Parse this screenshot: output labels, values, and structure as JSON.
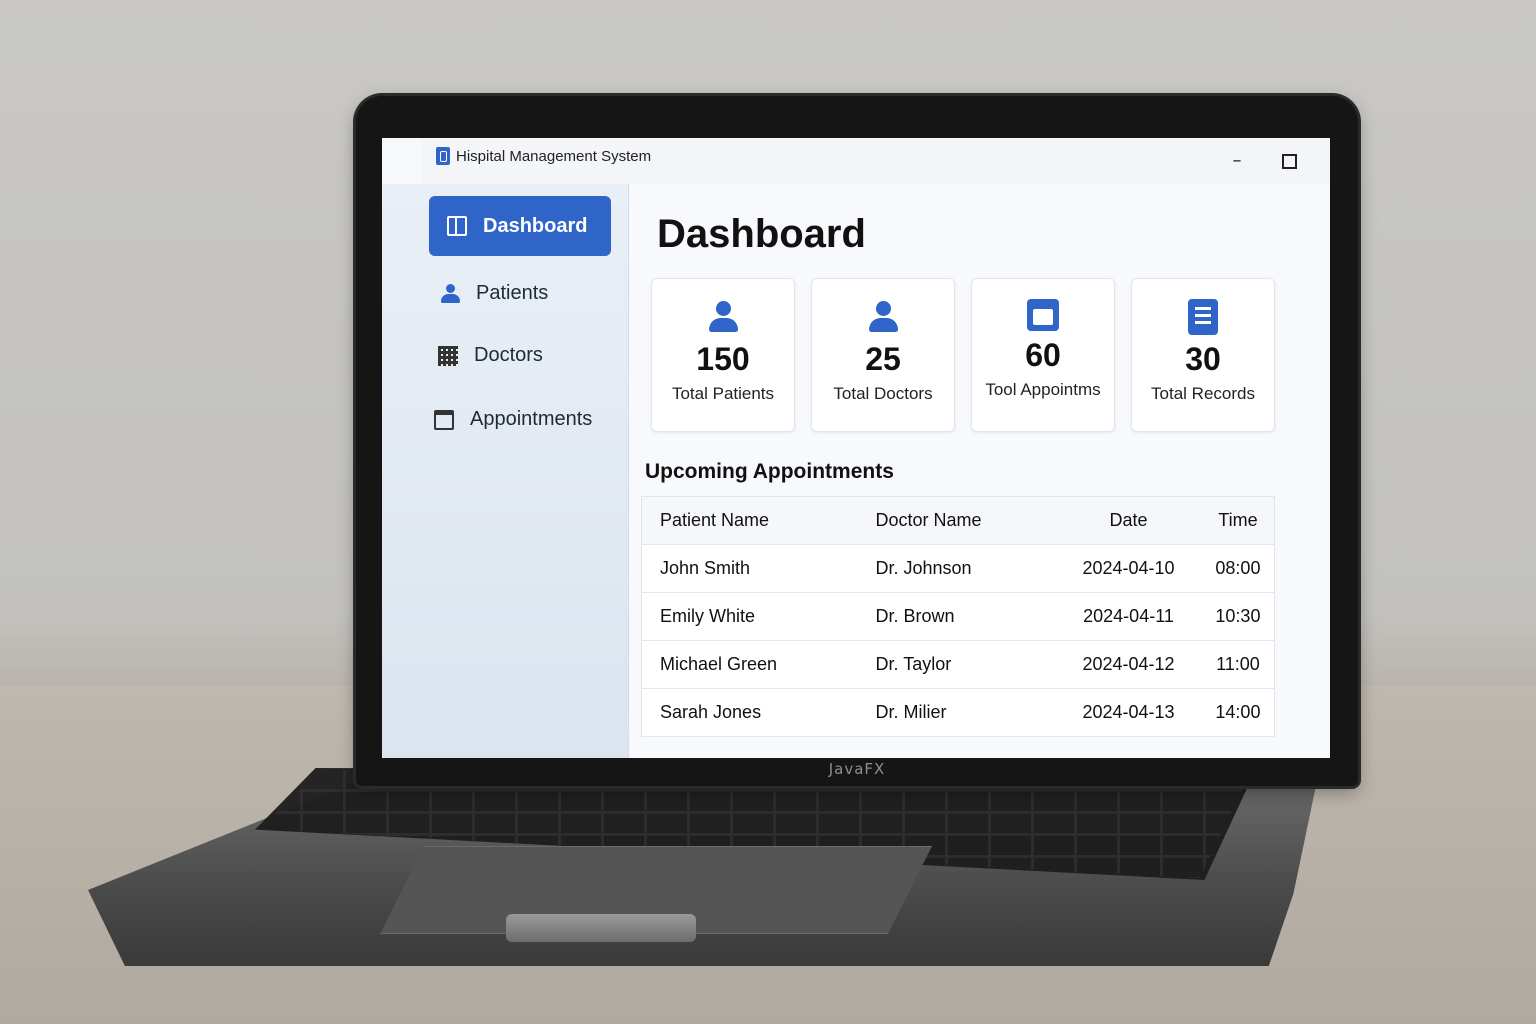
{
  "device": {
    "brand_label": "JavaFX"
  },
  "window": {
    "title": "Hispital Management System",
    "controls": {
      "minimize": "–",
      "close": "✕"
    }
  },
  "sidebar": {
    "items": [
      {
        "label": "Dashboard",
        "icon": "dashboard-icon",
        "active": true
      },
      {
        "label": "Patients",
        "icon": "person-icon",
        "active": false
      },
      {
        "label": "Doctors",
        "icon": "building-icon",
        "active": false
      },
      {
        "label": "Appointments",
        "icon": "calendar-icon",
        "active": false
      }
    ]
  },
  "main": {
    "page_title": "Dashboard",
    "cards": [
      {
        "value": "150",
        "label": "Total Patients",
        "icon": "person-icon"
      },
      {
        "value": "25",
        "label": "Total Doctors",
        "icon": "person-icon"
      },
      {
        "value": "60",
        "label": "Tool Appointms",
        "icon": "calendar-icon"
      },
      {
        "value": "30",
        "label": "Total Records",
        "icon": "document-icon"
      }
    ],
    "appointments": {
      "title": "Upcoming Appointments",
      "columns": [
        "Patient Name",
        "Doctor Name",
        "Date",
        "Time"
      ],
      "rows": [
        [
          "John Smith",
          "Dr. Johnson",
          "2024-04-10",
          "08:00"
        ],
        [
          "Emily White",
          "Dr. Brown",
          "2024-04-11",
          "10:30"
        ],
        [
          "Michael Green",
          "Dr. Taylor",
          "2024-04-12",
          "11:00"
        ],
        [
          "Sarah Jones",
          "Dr. Milier",
          "2024-04-13",
          "14:00"
        ]
      ]
    }
  },
  "colors": {
    "accent": "#2f64c8",
    "sidebar_bg": "#e3eaf3",
    "content_bg": "#f7f9fc"
  }
}
